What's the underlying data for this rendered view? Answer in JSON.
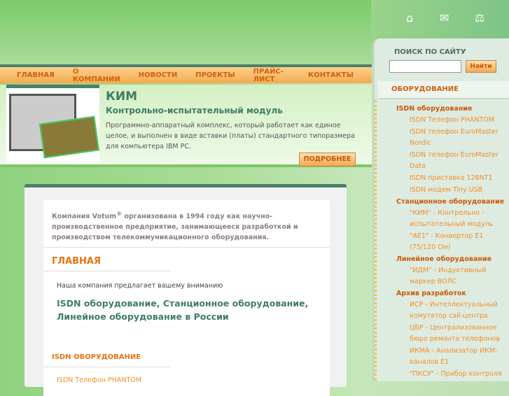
{
  "header": {
    "icons": [
      "home-icon",
      "mail-icon",
      "sitemap-icon"
    ]
  },
  "nav": [
    "ГЛАВНАЯ",
    "О КОМПАНИИ",
    "НОВОСТИ",
    "ПРОЕКТЫ",
    "ПРАЙС-ЛИСТ",
    "КОНТАКТЫ"
  ],
  "banner": {
    "title": "КИМ",
    "subtitle": "Контрольно-испытательный модуль",
    "text": "Программно-аппаратный комплекс, который работает как единое целое, и выполнен в виде вставки (платы) стандартного типоразмера для компьютера IBM PC.",
    "more": "ПОДРОБНЕЕ"
  },
  "main": {
    "intro_a": "Компания Votum",
    "intro_reg": "®",
    "intro_b": " организована в 1994 году как научно-производственное предприятие, занимающееся разработкой и производством телекоммуникационного оборудования.",
    "heading": "ГЛАВНАЯ",
    "offer": "Наша компания предлагает вашему вниманию",
    "big": "ISDN оборудование, Станционное оборудование, Линейное оборудование в России",
    "isdn_heading": "ISDN ОБОРУДОВАНИЕ",
    "isdn_link": "ISDN Телефон PHANTOM"
  },
  "sidebar": {
    "search_title": "ПОИСК ПО САЙТУ",
    "search_value": "",
    "search_button": "Найти",
    "equipment": "ОБОРУДОВАНИЕ",
    "categories": [
      {
        "name": "ISDN оборудование",
        "items": [
          "ISDN Телефон PHANTOM",
          "ISDN телефон EuroMaster Nordic",
          "ISDN телефон EuroMaster Data",
          "ISDN приставка 128NT1",
          "ISDN модем Tiny USB"
        ]
      },
      {
        "name": "Станционное оборудование",
        "items": [
          "\"КИМ\" - Контрольно - испытательный модуль",
          "\"АЕ1\" - Конвертор Е1 (75/120 Ом)"
        ]
      },
      {
        "name": "Линейное оборудование",
        "items": [
          "\"ИДМ\" - Индуктивный маркер ВОЛС"
        ]
      },
      {
        "name": "Архив разработок",
        "items": [
          "ИСР - Интеллектуальный комутатор call-центра",
          "ЦБР - Централизованное бюро ремонта телефонов",
          "ИКМА - Анализатор ИКМ-каналов Е1",
          "\"ПКСУ\" - Прибор контроля"
        ]
      }
    ]
  }
}
